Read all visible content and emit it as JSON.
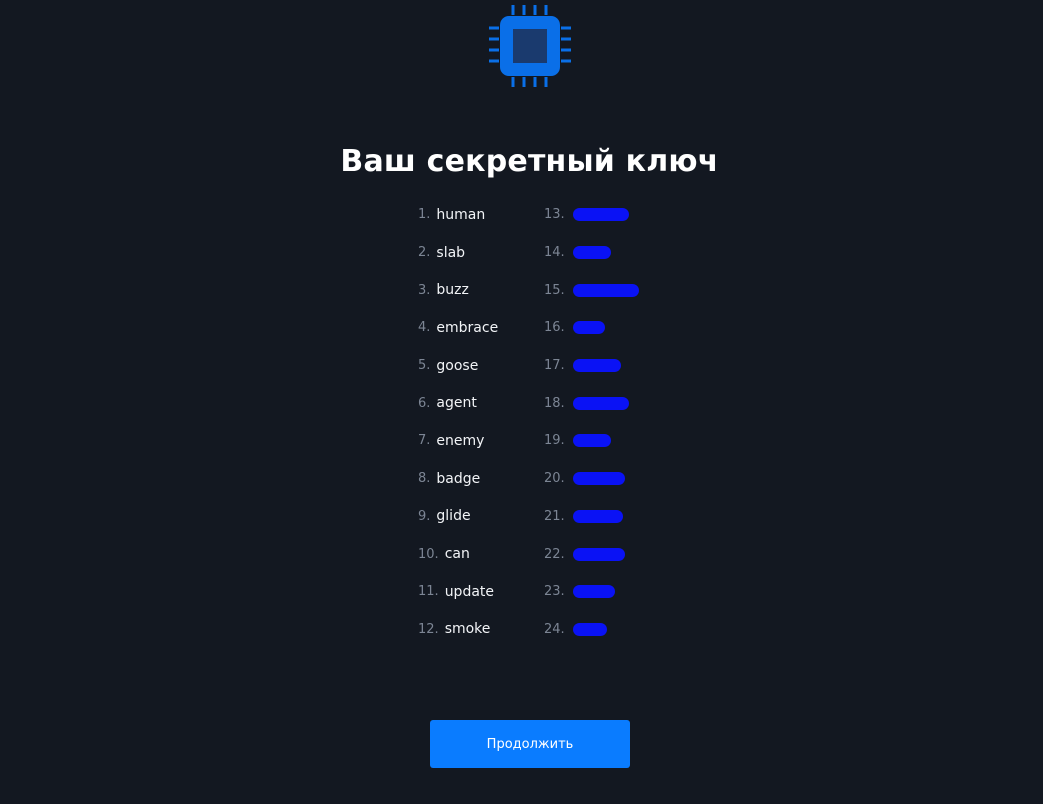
{
  "colors": {
    "background": "#131821",
    "accent": "#0a7cff",
    "chip_icon_outer": "#0a6fe8",
    "chip_icon_inner": "#1a3a6e",
    "number": "#7c8594",
    "word": "#f2f4f7",
    "redaction": "#0a12f5"
  },
  "header": {
    "icon": "cpu-chip-icon",
    "title": "Ваш секретный ключ"
  },
  "seed_words": [
    {
      "num": "1.",
      "word": "human"
    },
    {
      "num": "2.",
      "word": "slab"
    },
    {
      "num": "3.",
      "word": "buzz"
    },
    {
      "num": "4.",
      "word": "embrace"
    },
    {
      "num": "5.",
      "word": "goose"
    },
    {
      "num": "6.",
      "word": "agent"
    },
    {
      "num": "7.",
      "word": "enemy"
    },
    {
      "num": "8.",
      "word": "badge"
    },
    {
      "num": "9.",
      "word": "glide"
    },
    {
      "num": "10.",
      "word": "can"
    },
    {
      "num": "11.",
      "word": "update"
    },
    {
      "num": "12.",
      "word": "smoke"
    }
  ],
  "redacted_words": [
    {
      "num": "13."
    },
    {
      "num": "14."
    },
    {
      "num": "15."
    },
    {
      "num": "16."
    },
    {
      "num": "17."
    },
    {
      "num": "18."
    },
    {
      "num": "19."
    },
    {
      "num": "20."
    },
    {
      "num": "21."
    },
    {
      "num": "22."
    },
    {
      "num": "23."
    },
    {
      "num": "24."
    }
  ],
  "actions": {
    "continue_label": "Продолжить"
  }
}
